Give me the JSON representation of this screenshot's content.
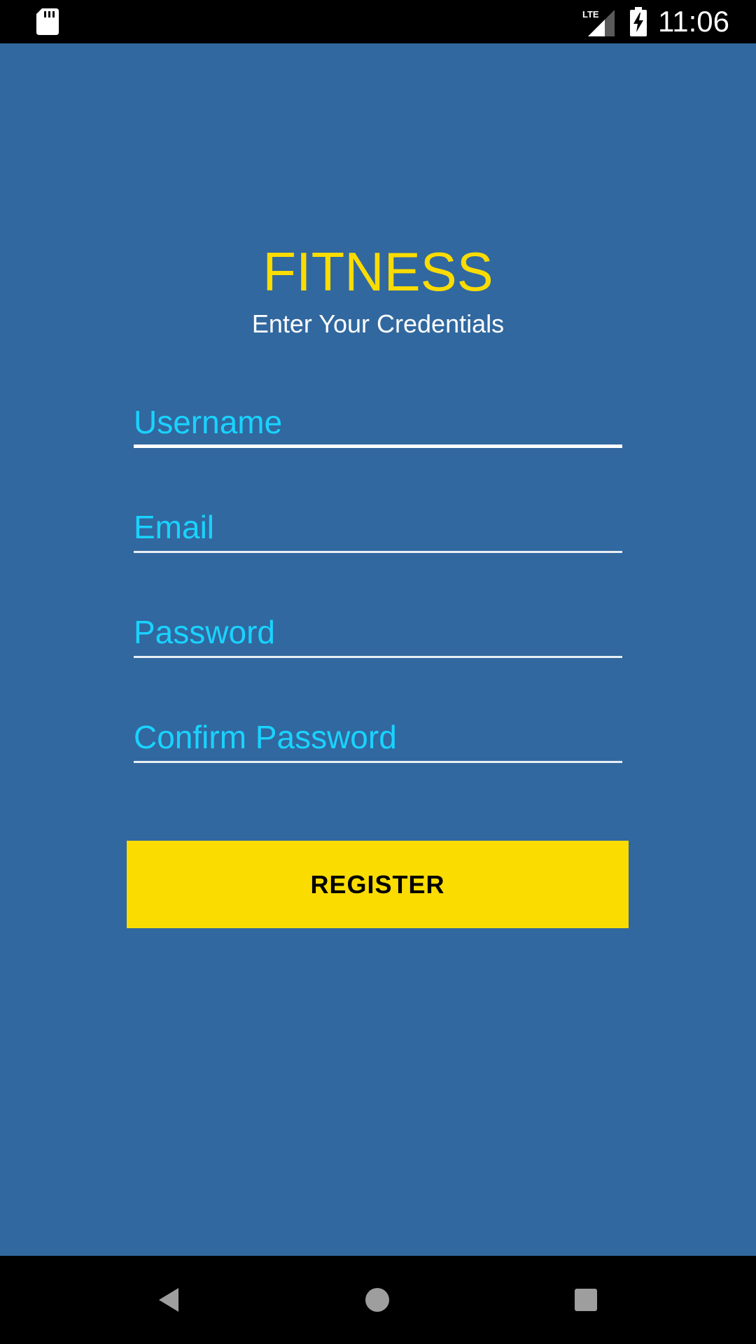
{
  "status_bar": {
    "time": "11:06",
    "network_label": "LTE",
    "icons": [
      "sd-card-icon",
      "lte-signal-icon",
      "battery-charging-icon"
    ]
  },
  "header": {
    "title": "FITNESS",
    "subtitle": "Enter Your Credentials"
  },
  "form": {
    "username": {
      "placeholder": "Username",
      "value": ""
    },
    "email": {
      "placeholder": "Email",
      "value": ""
    },
    "password": {
      "placeholder": "Password",
      "value": ""
    },
    "confirm_password": {
      "placeholder": "Confirm Password",
      "value": ""
    },
    "register_label": "REGISTER"
  },
  "nav_bar": {
    "icons": [
      "back-icon",
      "home-icon",
      "recents-icon"
    ]
  },
  "colors": {
    "background": "#31689f",
    "accent_yellow": "#fbdc00",
    "placeholder_cyan": "#19d3ff",
    "bar_black": "#000000"
  }
}
